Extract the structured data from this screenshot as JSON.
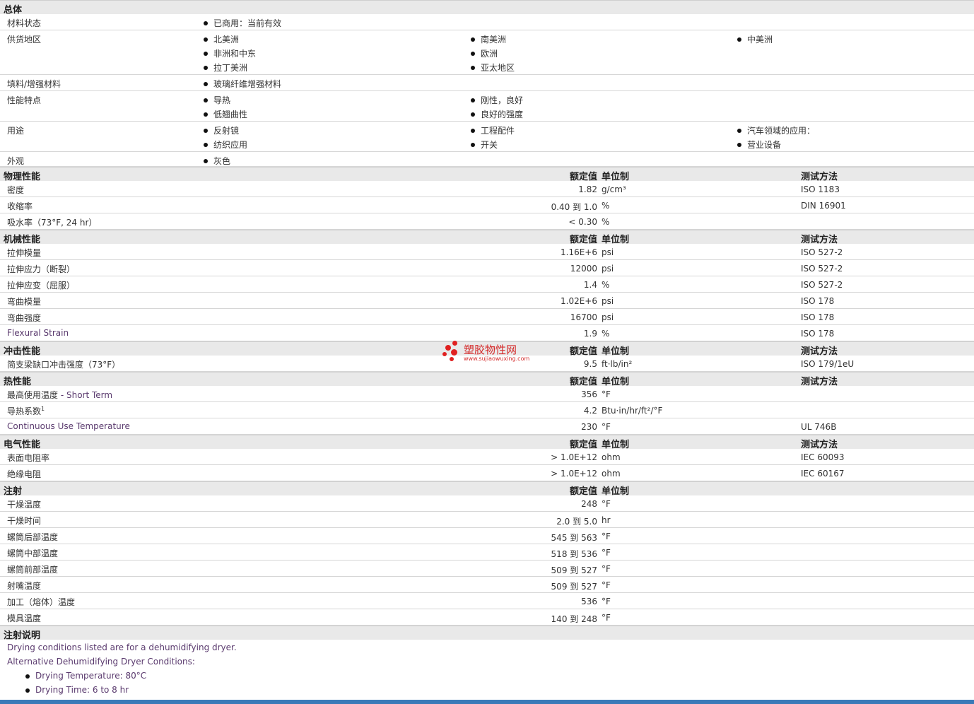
{
  "general": {
    "title": "总体",
    "rows": [
      {
        "label": "材料状态",
        "cols": [
          [
            "已商用：当前有效"
          ],
          [],
          []
        ]
      },
      {
        "label": "供货地区",
        "cols": [
          [
            "北美洲",
            "非洲和中东",
            "拉丁美洲"
          ],
          [
            "南美洲",
            "欧洲",
            "亚太地区"
          ],
          [
            "中美洲"
          ]
        ]
      },
      {
        "label": "填料/增强材料",
        "cols": [
          [
            "玻璃纤维增强材料"
          ],
          [],
          []
        ]
      },
      {
        "label": "性能特点",
        "cols": [
          [
            "导热",
            "低翘曲性"
          ],
          [
            "刚性，良好",
            "良好的强度"
          ],
          []
        ]
      },
      {
        "label": "用途",
        "cols": [
          [
            "反射镜",
            "纺织应用"
          ],
          [
            "工程配件",
            "开关"
          ],
          [
            "汽车领域的应用：",
            "营业设备"
          ]
        ]
      },
      {
        "label": "外观",
        "cols": [
          [
            "灰色"
          ],
          [],
          []
        ]
      }
    ]
  },
  "headers": {
    "nominal": "额定值",
    "unit": "单位制",
    "test": "测试方法"
  },
  "sections": [
    {
      "title": "物理性能",
      "show_test": true,
      "rows": [
        {
          "label": "密度",
          "value": "1.82",
          "unit": "g/cm³",
          "test": "ISO 1183"
        },
        {
          "label": "收缩率",
          "value": "0.40 到  1.0",
          "unit": "%",
          "test": "DIN 16901"
        },
        {
          "label": "吸水率（73°F, 24 hr）",
          "value": "< 0.30",
          "unit": "%",
          "test": ""
        }
      ]
    },
    {
      "title": "机械性能",
      "show_test": true,
      "rows": [
        {
          "label": "拉伸模量",
          "value": "1.16E+6",
          "unit": "psi",
          "test": "ISO 527-2"
        },
        {
          "label": "拉伸应力（断裂）",
          "value": "12000",
          "unit": "psi",
          "test": "ISO 527-2"
        },
        {
          "label": "拉伸应变（屈服）",
          "value": "1.4",
          "unit": "%",
          "test": "ISO 527-2"
        },
        {
          "label": "弯曲模量",
          "value": "1.02E+6",
          "unit": "psi",
          "test": "ISO 178"
        },
        {
          "label": "弯曲强度",
          "value": "16700",
          "unit": "psi",
          "test": "ISO 178"
        },
        {
          "label": "Flexural Strain",
          "en": true,
          "value": "1.9",
          "unit": "%",
          "test": "ISO 178"
        }
      ]
    },
    {
      "title": "冲击性能",
      "show_test": true,
      "rows": [
        {
          "label": "简支梁缺口冲击强度（73°F）",
          "value": "9.5",
          "unit": "ft·lb/in²",
          "test": "ISO 179/1eU"
        }
      ]
    },
    {
      "title": "热性能",
      "show_test": true,
      "rows": [
        {
          "label": "最高使用温度",
          "label_suffix": " - Short Term",
          "value": "356",
          "unit": "°F",
          "test": ""
        },
        {
          "label": "导热系数",
          "sup": "1",
          "value": "4.2",
          "unit": "Btu·in/hr/ft²/°F",
          "test": ""
        },
        {
          "label": "Continuous Use Temperature",
          "en": true,
          "value": "230",
          "unit": "°F",
          "test": "UL 746B"
        }
      ]
    },
    {
      "title": "电气性能",
      "show_test": true,
      "rows": [
        {
          "label": "表面电阻率",
          "value": "> 1.0E+12",
          "unit": "ohm",
          "test": "IEC 60093"
        },
        {
          "label": "绝缘电阻",
          "value": "> 1.0E+12",
          "unit": "ohm",
          "test": "IEC 60167"
        }
      ]
    },
    {
      "title": "注射",
      "show_test": false,
      "rows": [
        {
          "label": "干燥温度",
          "value": "248",
          "unit": "°F",
          "test": ""
        },
        {
          "label": "干燥时间",
          "value": "2.0 到  5.0",
          "unit": "hr",
          "test": ""
        },
        {
          "label": "螺筒后部温度",
          "value": "545 到  563",
          "unit": "°F",
          "test": ""
        },
        {
          "label": "螺筒中部温度",
          "value": "518 到  536",
          "unit": "°F",
          "test": ""
        },
        {
          "label": "螺筒前部温度",
          "value": "509 到  527",
          "unit": "°F",
          "test": ""
        },
        {
          "label": "射嘴温度",
          "value": "509 到  527",
          "unit": "°F",
          "test": ""
        },
        {
          "label": "加工（熔体）温度",
          "value": "536",
          "unit": "°F",
          "test": ""
        },
        {
          "label": "模具温度",
          "value": "140 到  248",
          "unit": "°F",
          "test": ""
        }
      ]
    }
  ],
  "notes": {
    "title": "注射说明",
    "lines": [
      "Drying conditions listed are for a dehumidifying dryer.",
      "Alternative Dehumidifying Dryer Conditions:"
    ],
    "bullets": [
      "Drying Temperature: 80°C",
      "Drying Time: 6 to 8 hr"
    ]
  },
  "watermark": {
    "text": "塑胶物性网",
    "url": "www.sujiaowuxing.com",
    "color": "#d42a2a"
  },
  "colors": {
    "section_bg": "#e9e9e9",
    "english_text": "#5a3a6e",
    "bottom_bar": "#3a7ab8"
  }
}
